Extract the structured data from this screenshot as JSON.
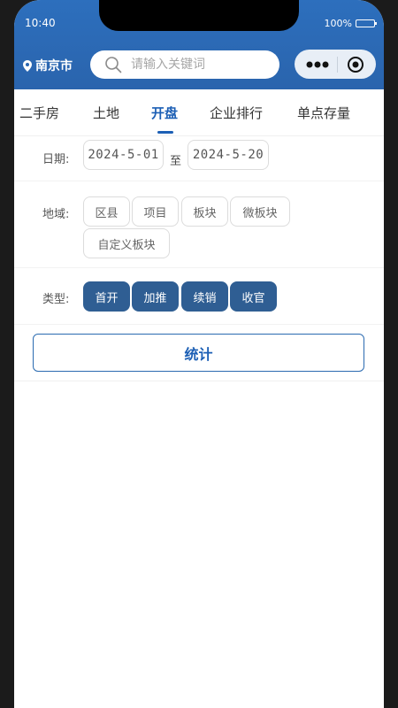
{
  "status": {
    "time": "10:40",
    "battery": "100%"
  },
  "header": {
    "city": "南京市",
    "search_placeholder": "请输入关键词"
  },
  "tabs": [
    {
      "label": "二手房"
    },
    {
      "label": "土地"
    },
    {
      "label": "开盘",
      "active": true
    },
    {
      "label": "企业排行"
    },
    {
      "label": "单点存量"
    }
  ],
  "date": {
    "label": "日期:",
    "start": "2024-5-01",
    "to": "至",
    "end": "2024-5-20"
  },
  "region": {
    "label": "地域:",
    "options": [
      "区县",
      "项目",
      "板块",
      "微板块",
      "自定义板块"
    ]
  },
  "type": {
    "label": "类型:",
    "options": [
      "首开",
      "加推",
      "续销",
      "收官"
    ]
  },
  "stat_button": "统计",
  "colors": {
    "brand": "#2a64ad",
    "accent": "#1c5fb5",
    "chip_selected": "#2f5e93"
  }
}
